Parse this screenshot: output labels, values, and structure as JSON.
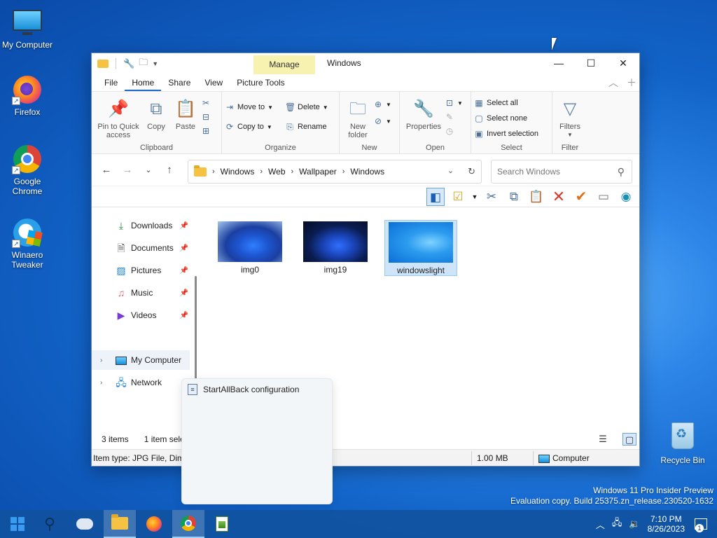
{
  "desktop": {
    "icons": [
      {
        "label": "My Computer"
      },
      {
        "label": "Firefox"
      },
      {
        "label": "Google Chrome"
      },
      {
        "label": "Winaero Tweaker"
      },
      {
        "label": "Recycle Bin"
      }
    ]
  },
  "explorer": {
    "title": "Windows",
    "context_tab": "Manage",
    "tabs": [
      "File",
      "Home",
      "Share",
      "View",
      "Picture Tools"
    ],
    "active_tab": "Home",
    "window_controls": {
      "minimize": "—",
      "maximize": "☐",
      "close": "✕"
    },
    "ribbon": {
      "clipboard": {
        "label": "Clipboard",
        "pin": "Pin to Quick access",
        "copy": "Copy",
        "paste": "Paste"
      },
      "organize": {
        "label": "Organize",
        "move_to": "Move to",
        "copy_to": "Copy to",
        "delete": "Delete",
        "rename": "Rename"
      },
      "new": {
        "label": "New",
        "new_folder": "New folder"
      },
      "open": {
        "label": "Open",
        "properties": "Properties"
      },
      "select": {
        "label": "Select",
        "select_all": "Select all",
        "select_none": "Select none",
        "invert": "Invert selection"
      },
      "filter": {
        "label": "Filter",
        "filters": "Filters"
      }
    },
    "address": {
      "crumbs": [
        "Windows",
        "Web",
        "Wallpaper",
        "Windows"
      ]
    },
    "search": {
      "placeholder": "Search Windows"
    },
    "nav": {
      "items": [
        {
          "label": "Downloads",
          "icon": "download-icon"
        },
        {
          "label": "Documents",
          "icon": "documents-icon"
        },
        {
          "label": "Pictures",
          "icon": "pictures-icon"
        },
        {
          "label": "Music",
          "icon": "music-icon"
        },
        {
          "label": "Videos",
          "icon": "videos-icon"
        },
        {
          "label": "My Computer",
          "icon": "computer-icon"
        },
        {
          "label": "Network",
          "icon": "network-icon"
        }
      ]
    },
    "files": [
      {
        "name": "img0"
      },
      {
        "name": "img19"
      },
      {
        "name": "windowslight",
        "selected": true
      }
    ],
    "status": {
      "count": "3 items",
      "selected": "1 item sele"
    },
    "details_bar": {
      "item_type": "Item type: JPG File, Dime",
      "size": "1.00 MB",
      "location": "Computer"
    }
  },
  "popup": {
    "item": "StartAllBack configuration"
  },
  "watermark": {
    "line1": "Windows 11 Pro Insider Preview",
    "line2": "Evaluation copy. Build 25375.zn_release.230520-1632"
  },
  "taskbar": {
    "time": "7:10 PM",
    "date": "8/26/2023",
    "notifications": "1"
  }
}
